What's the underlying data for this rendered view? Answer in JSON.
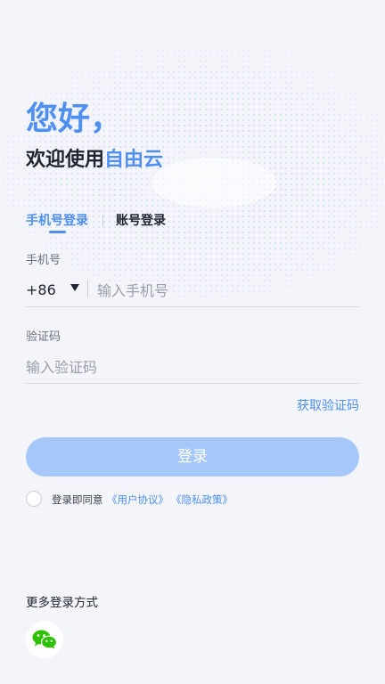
{
  "header": {
    "greeting": "您好，",
    "welcome_prefix": "欢迎使用",
    "brand_name": "自由云"
  },
  "tabs": [
    {
      "label": "手机号登录",
      "active": true
    },
    {
      "label": "账号登录",
      "active": false
    }
  ],
  "phone_field": {
    "label": "手机号",
    "country_code": "+86",
    "placeholder": "输入手机号",
    "value": ""
  },
  "code_field": {
    "label": "验证码",
    "placeholder": "输入验证码",
    "value": ""
  },
  "get_code_label": "获取验证码",
  "login_button_label": "登录",
  "agreement": {
    "checked": false,
    "prefix": "登录即同意",
    "terms_link": "《用户协议》",
    "privacy_link": "《隐私政策》"
  },
  "more_login": {
    "title": "更多登录方式",
    "options": [
      {
        "icon": "wechat-icon"
      }
    ]
  },
  "colors": {
    "accent": "#4e8ff0",
    "button_disabled": "#a6c8f8",
    "background": "#f3f5fa",
    "wechat_green": "#2dc100"
  }
}
